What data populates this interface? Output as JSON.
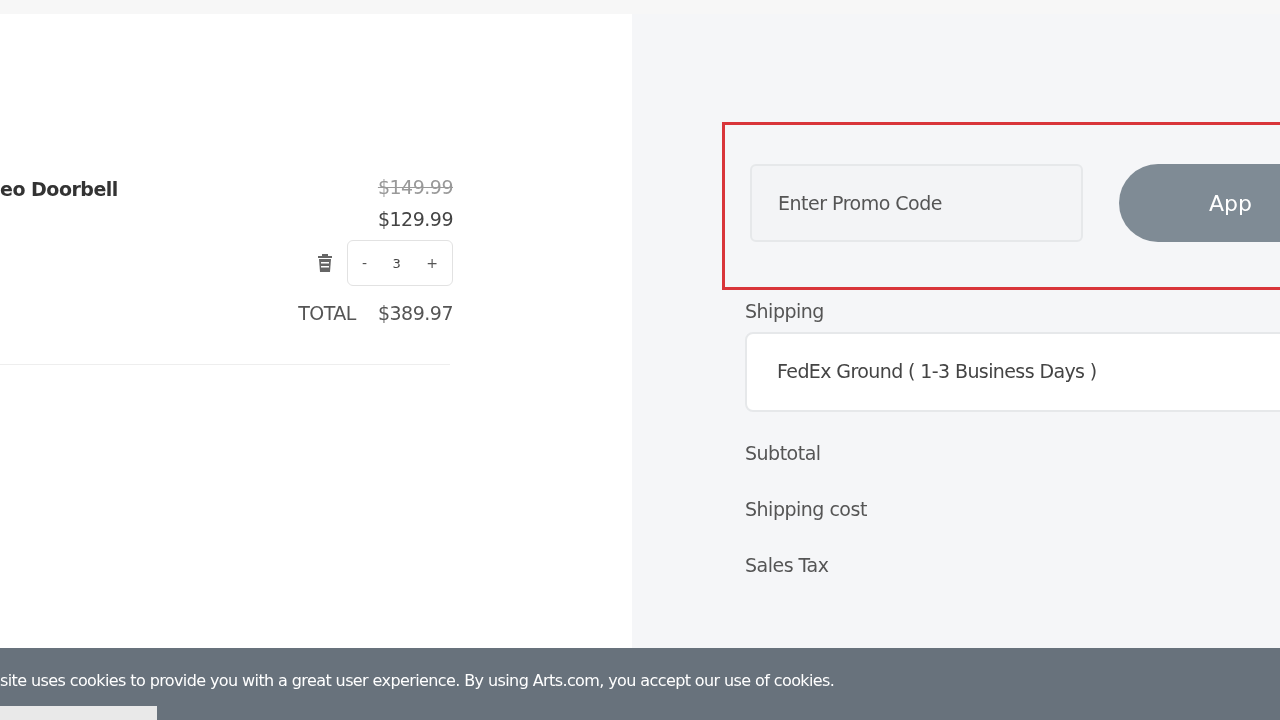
{
  "cart_item": {
    "name": "eo Doorbell",
    "original_price": "$149.99",
    "price": "$129.99",
    "quantity": "3",
    "decrement": "-",
    "increment": "+",
    "total_label": "TOTAL",
    "total": "$389.97"
  },
  "promo": {
    "placeholder": "Enter Promo Code",
    "button": "App",
    "highlighted": true
  },
  "shipping": {
    "label": "Shipping",
    "value": "FedEx Ground ( 1-3 Business Days )"
  },
  "summary": [
    "Subtotal",
    "Shipping cost",
    "Sales Tax"
  ],
  "cookie_banner": {
    "text": "site uses cookies to provide you with a great user experience. By using Arts.com, you accept our use of cookies."
  }
}
